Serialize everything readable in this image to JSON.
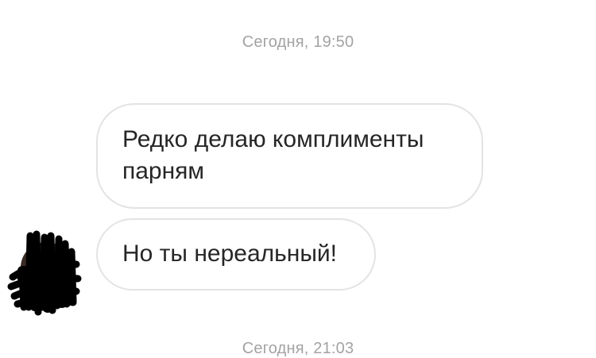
{
  "conversation": {
    "timestamps": {
      "top": "Сегодня, 19:50",
      "bottom": "Сегодня, 21:03"
    },
    "messages": [
      {
        "text": "Редко делаю комплименты парням"
      },
      {
        "text": "Но ты нереальный!"
      }
    ],
    "avatar": {
      "icon": "avatar-scribbled-out",
      "scribble_color": "#000000"
    },
    "colors": {
      "bubble_border": "#e3e3e3",
      "message_text": "#262626",
      "timestamp_text": "#a3a3a3"
    }
  }
}
